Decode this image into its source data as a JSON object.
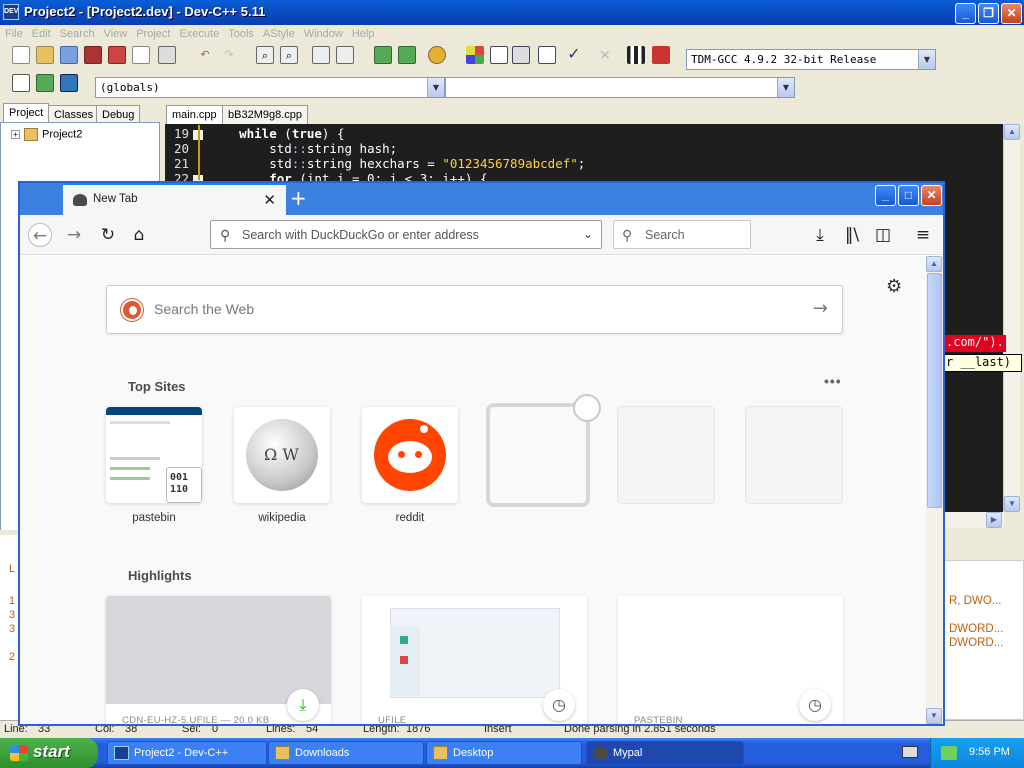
{
  "devcpp": {
    "title": "Project2 - [Project2.dev] - Dev-C++ 5.11",
    "menu": [
      "File",
      "Edit",
      "Search",
      "View",
      "Project",
      "Execute",
      "Tools",
      "AStyle",
      "Window",
      "Help"
    ],
    "compiler_select": "TDM-GCC 4.9.2 32-bit Release",
    "scope_select": "(globals)",
    "function_select": "",
    "panel_tabs": [
      "Project",
      "Classes",
      "Debug"
    ],
    "tree_root": "Project2",
    "editor_tabs": [
      "main.cpp",
      "bB32M9g8.cpp"
    ],
    "code_lines": [
      {
        "num": "19",
        "indent": "    ",
        "parts": [
          {
            "t": "while",
            "c": "kw"
          },
          {
            "t": " (",
            "c": ""
          },
          {
            "t": "true",
            "c": "kw"
          },
          {
            "t": ") {",
            "c": ""
          }
        ]
      },
      {
        "num": "20",
        "indent": "        ",
        "parts": [
          {
            "t": "std",
            "c": ""
          },
          {
            "t": "::",
            "c": "ns"
          },
          {
            "t": "string hash;",
            "c": ""
          }
        ]
      },
      {
        "num": "21",
        "indent": "        ",
        "parts": [
          {
            "t": "std",
            "c": ""
          },
          {
            "t": "::",
            "c": "ns"
          },
          {
            "t": "string hexchars = ",
            "c": ""
          },
          {
            "t": "\"0123456789abcdef\"",
            "c": "str"
          },
          {
            "t": ";",
            "c": ""
          }
        ]
      },
      {
        "num": "22",
        "indent": "        ",
        "parts": [
          {
            "t": "for",
            "c": "kw"
          },
          {
            "t": " (int i = 0; i < 3; i++) {",
            "c": ""
          }
        ]
      }
    ],
    "peek_red_text": ".com/\").",
    "peek_tooltip": "r __last)",
    "compiler_rows": [
      "R, DWO...",
      "DWORD...",
      "DWORD..."
    ],
    "left_strip_rows": [
      "L",
      "1",
      "3",
      "3",
      "2"
    ],
    "status": {
      "line_label": "Line:",
      "line_val": "33",
      "col_label": "Col:",
      "col_val": "38",
      "sel_label": "Sel:",
      "sel_val": "0",
      "lines_label": "Lines:",
      "lines_val": "54",
      "length_label": "Length:",
      "length_val": "1876",
      "mode": "Insert",
      "message": "Done parsing in 2.851 seconds"
    }
  },
  "firefox": {
    "tab_label": "New Tab",
    "url_placeholder": "Search with DuckDuckGo or enter address",
    "search_placeholder": "Search",
    "web_search_placeholder": "Search the Web",
    "top_sites_title": "Top Sites",
    "top_sites": [
      {
        "label": "pastebin"
      },
      {
        "label": "wikipedia"
      },
      {
        "label": "reddit"
      }
    ],
    "highlights_title": "Highlights",
    "highlights": [
      {
        "caption": "CDN-EU-HZ-5.UFILE — 20.0 KB",
        "badge": "download-icon"
      },
      {
        "caption": "UFILE",
        "badge": "clock-icon"
      },
      {
        "caption": "PASTEBIN",
        "badge": "clock-icon"
      }
    ],
    "colors": {
      "accent": "#0a84ff",
      "reddit": "#ff4500",
      "download": "#12bc00"
    }
  },
  "taskbar": {
    "start_label": "start",
    "tasks": [
      {
        "label": "Project2 - Dev-C++"
      },
      {
        "label": "Downloads"
      },
      {
        "label": "Desktop"
      },
      {
        "label": "Mypal"
      }
    ],
    "clock": "9:56 PM"
  }
}
